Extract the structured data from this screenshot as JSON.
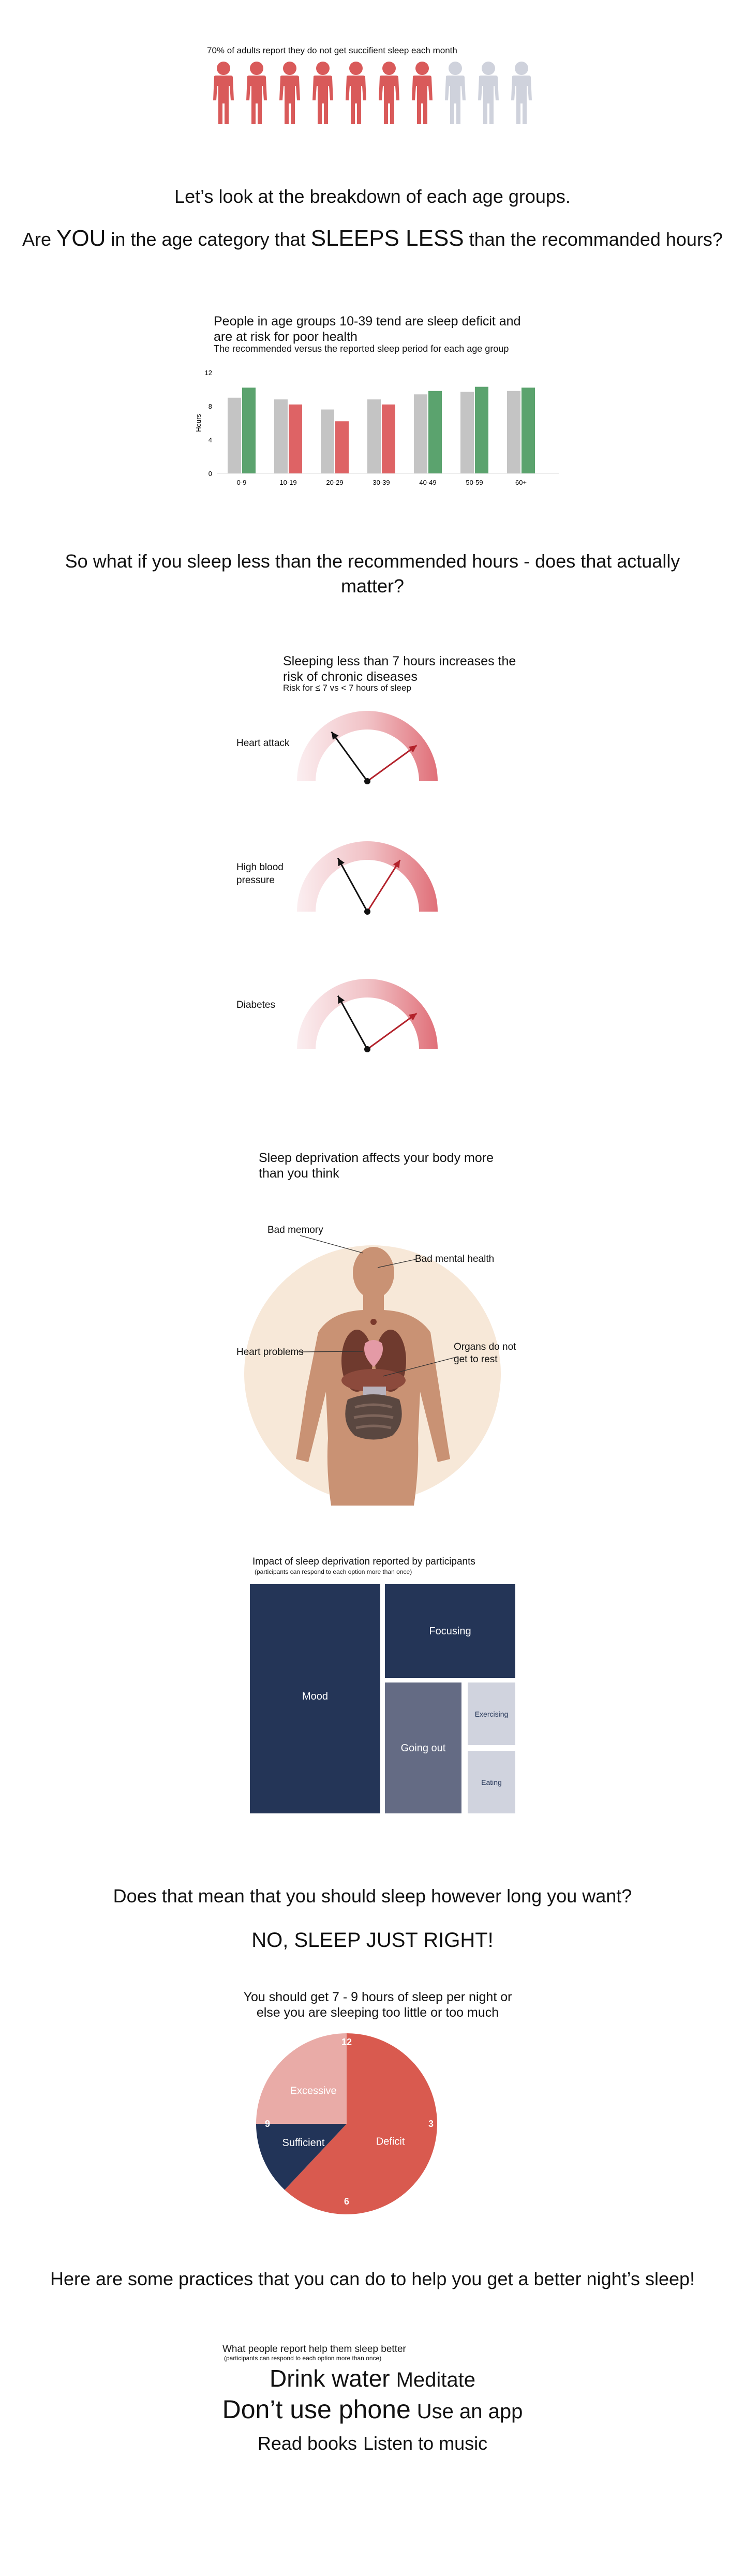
{
  "people": {
    "title": "70% of adults report they do not get succifient sleep each month",
    "total": 10,
    "highlighted": 7,
    "color_on": "#d95a5a",
    "color_off": "#cfd2dc"
  },
  "intro": {
    "line1": "Let’s look at the breakdown of each age groups.",
    "line2_a": "Are ",
    "line2_you": "YOU",
    "line2_b": " in the age category that ",
    "line2_sleeps": "SLEEPS LESS",
    "line2_c": " than the recommanded hours?"
  },
  "chart_data": [
    {
      "type": "bar",
      "title": "People in age groups 10-39 tend are sleep deficit and are at risk for poor health",
      "subtitle": "The recommended versus the reported sleep period for each age group",
      "ylabel": "Hours",
      "ylim": [
        0,
        12
      ],
      "yticks": [
        0,
        4,
        8,
        12
      ],
      "categories": [
        "0-9",
        "10-19",
        "20-29",
        "30-39",
        "40-49",
        "50-59",
        "60+"
      ],
      "series": [
        {
          "values": [
            9.0,
            8.8,
            7.6,
            8.8,
            9.4,
            9.7,
            9.8
          ],
          "color": "#c4c4c4"
        },
        {
          "values": [
            10.2,
            8.2,
            6.2,
            8.2,
            9.8,
            10.3,
            10.2
          ],
          "color_good": "#5ba36e",
          "color_bad": "#de6365"
        }
      ],
      "grid": false
    },
    {
      "type": "gauge",
      "title": "Sleeping less than 7 hours increases the risk of chronic diseases",
      "subtitle": "Risk for ≤ 7  vs < 7 hours of sleep",
      "items": [
        {
          "label": "Heart attack",
          "needle_a": 0.3,
          "needle_b": 0.8
        },
        {
          "label": "High blood pressure",
          "needle_a": 0.34,
          "needle_b": 0.68
        },
        {
          "label": "Diabetes",
          "needle_a": 0.34,
          "needle_b": 0.8
        }
      ]
    },
    {
      "type": "treemap",
      "title": "Impact of sleep deprivation reported by participants",
      "note": "(participants can respond to each option more than once)",
      "items": [
        {
          "label": "Mood",
          "color": "#243557"
        },
        {
          "label": "Focusing",
          "color": "#243557"
        },
        {
          "label": "Going out",
          "color": "#646b84"
        },
        {
          "label": "Exercising",
          "color": "#d0d3de"
        },
        {
          "label": "Eating",
          "color": "#d0d3de"
        }
      ]
    },
    {
      "type": "pie",
      "title": "You should get 7 - 9 hours of sleep per night or else you are sleeping too little or too much",
      "slices": [
        {
          "label": "Deficit",
          "value": 62,
          "color": "#d95a4f"
        },
        {
          "label": "Sufficient",
          "value": 13,
          "color": "#223458"
        },
        {
          "label": "Excessive",
          "value": 25,
          "color": "#e9aba7"
        }
      ],
      "tick_labels": [
        "12",
        "3",
        "6",
        "9"
      ]
    }
  ],
  "matter": {
    "line1": "So what if you sleep less than the recommended hours - does that actually",
    "line2": "matter?"
  },
  "body": {
    "title": "Sleep deprivation affects your body more than you think",
    "labels": {
      "memory": "Bad memory",
      "mental": "Bad mental health",
      "heart": "Heart problems",
      "organs_1": "Organs do not",
      "organs_2": "get to rest"
    }
  },
  "just_right": {
    "question": "Does that mean that you should sleep however long you want?",
    "answer": "NO, SLEEP JUST RIGHT!"
  },
  "practices": {
    "heading": "Here are some practices that you can do to help you get a better night’s sleep!",
    "title": "What people report help them sleep better",
    "note": "(participants can respond to each option more than once)",
    "words_row1": [
      "Drink water",
      "Meditate"
    ],
    "words_row2": [
      "Don’t use phone",
      "Use an app"
    ],
    "words_row3": [
      "Read books",
      "Listen to music"
    ]
  }
}
